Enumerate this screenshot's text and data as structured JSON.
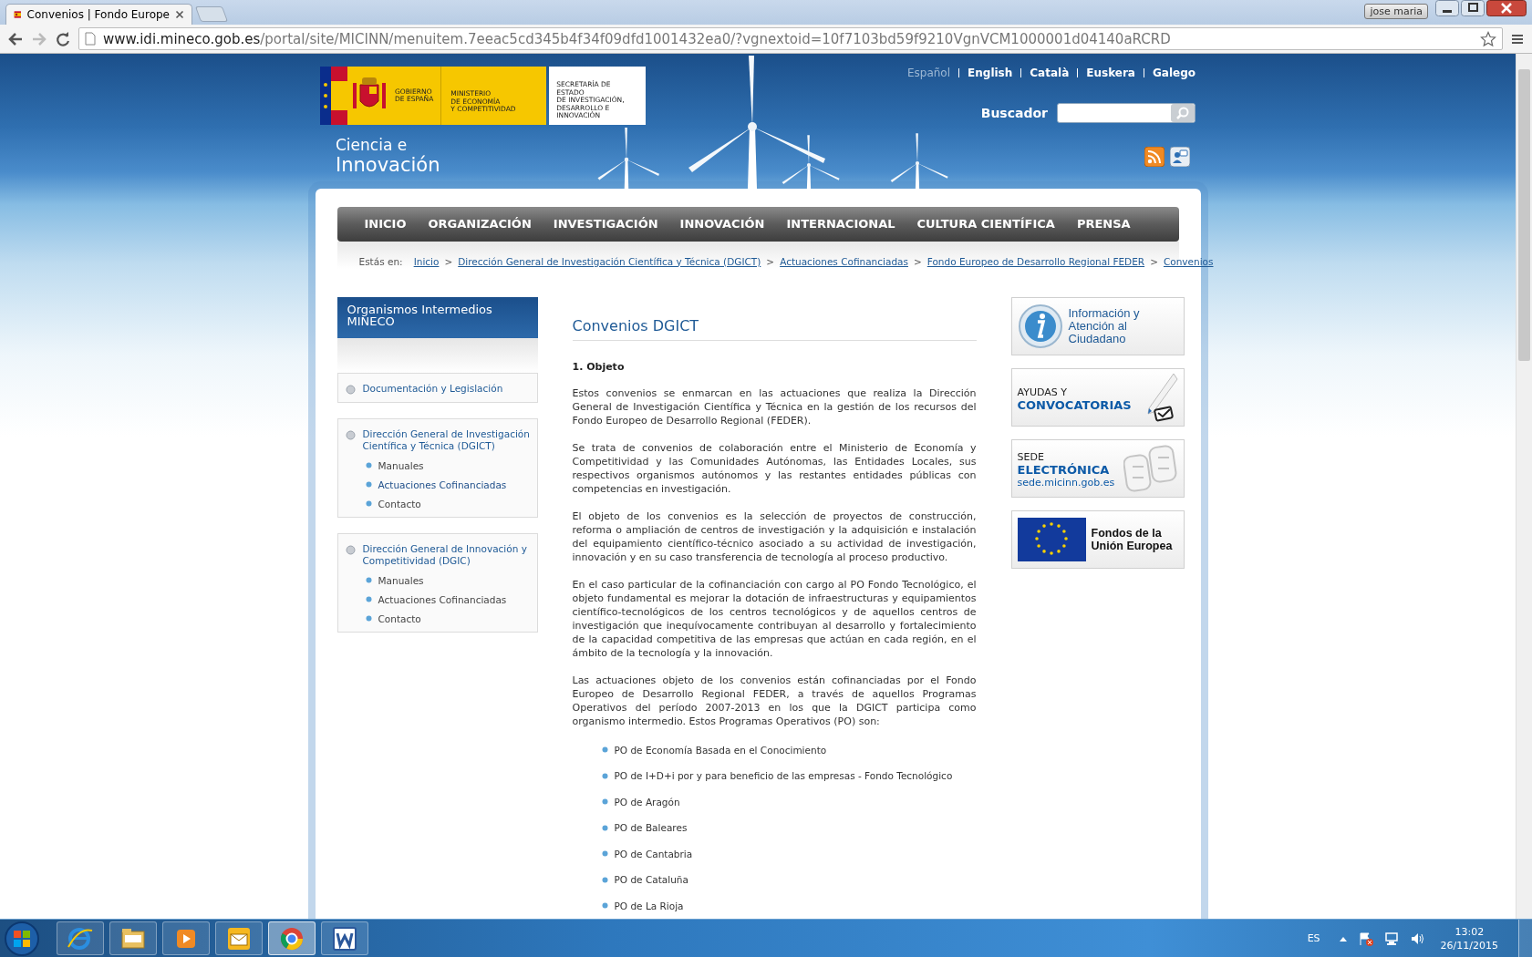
{
  "browser": {
    "tabs": [
      {
        "title": "Convenios | Fondo Europe",
        "selected": true
      }
    ],
    "user": "jose maria",
    "url_host": "www.idi.mineco.gob.es",
    "url_path": "/portal/site/MICINN/menuitem.7eeac5cd345b4f34f09dfd1001432ea0/?vgnextoid=10f7103bd59f9210VgnVCM1000001d04140aRCRD"
  },
  "header": {
    "logo": {
      "government": [
        "GOBIERNO",
        "DE ESPAÑA"
      ],
      "ministry": [
        "MINISTERIO",
        "DE ECONOMÍA",
        "Y COMPETITIVIDAD"
      ],
      "secretariat": [
        "SECRETARÍA DE ESTADO",
        "DE INVESTIGACIÓN,",
        "DESARROLLO E",
        "INNOVACIÓN"
      ]
    },
    "site_title": [
      "Ciencia e",
      "Innovación"
    ],
    "languages": [
      {
        "label": "Español",
        "selected": true
      },
      {
        "label": "English",
        "selected": false
      },
      {
        "label": "Català",
        "selected": false
      },
      {
        "label": "Euskera",
        "selected": false
      },
      {
        "label": "Galego",
        "selected": false
      }
    ],
    "search": {
      "label": "Buscador"
    }
  },
  "nav": [
    {
      "label": "INICIO",
      "selected": false
    },
    {
      "label": "ORGANIZACIÓN",
      "selected": false
    },
    {
      "label": "INVESTIGACIÓN",
      "selected": false
    },
    {
      "label": "INNOVACIÓN",
      "selected": false
    },
    {
      "label": "INTERNACIONAL",
      "selected": false
    },
    {
      "label": "CULTURA CIENTÍFICA",
      "selected": false
    },
    {
      "label": "PRENSA",
      "selected": false
    }
  ],
  "breadcrumb": {
    "label": "Estás en:",
    "separator": ">",
    "links": [
      "Inicio",
      "Dirección General de Investigación Científica y Técnica (DGICT)",
      "Actuaciones Cofinanciadas",
      "Fondo Europeo de Desarrollo Regional FEDER",
      "Convenios"
    ]
  },
  "sidebar": {
    "title": "Organismos Intermedios MINECO",
    "groups": [
      {
        "label": "Documentación y Legislación"
      },
      {
        "label": "Dirección General de Investigación Científica y Técnica (DGICT)",
        "children": [
          {
            "label": "Manuales",
            "selected": false
          },
          {
            "label": "Actuaciones Cofinanciadas",
            "selected": true
          },
          {
            "label": "Contacto",
            "selected": false
          }
        ]
      },
      {
        "label": "Dirección General de Innovación y Competitividad (DGIC)",
        "children": [
          {
            "label": "Manuales",
            "selected": false
          },
          {
            "label": "Actuaciones Cofinanciadas",
            "selected": false
          },
          {
            "label": "Contacto",
            "selected": false
          }
        ]
      }
    ]
  },
  "main": {
    "title": "Convenios DGICT",
    "heading": "1. Objeto",
    "paragraphs": [
      "Estos convenios se enmarcan en las actuaciones que realiza la Dirección General de Investigación Científica y Técnica en la gestión de los recursos del Fondo Europeo de Desarrollo Regional (FEDER).",
      "Se trata de convenios de colaboración entre el Ministerio de Economía y Competitividad y las Comunidades Autónomas, las Entidades Locales, sus respectivos organismos autónomos y las restantes entidades públicas con competencias en investigación.",
      "El objeto de los convenios es la selección de proyectos de construcción, reforma o ampliación de centros de investigación y la adquisición e instalación del equipamiento científico-técnico asociado a su actividad de investigación, innovación y en su caso transferencia de tecnología al proceso productivo.",
      "En el caso particular de la cofinanciación con cargo al PO Fondo Tecnológico, el objeto fundamental es mejorar la dotación de infraestructuras y equipamientos científico-tecnológicos de los centros tecnológicos y de aquellos centros de investigación que inequívocamente contribuyan al desarrollo y fortalecimiento de la capacidad competitiva de las empresas que actúan en cada región, en el ámbito de la tecnología y la innovación.",
      "Las actuaciones objeto de los convenios están cofinanciadas por el Fondo Europeo de Desarrollo Regional FEDER, a través de aquellos Programas Operativos del período 2007-2013 en los que la DGICT participa como organismo intermedio. Estos Programas Operativos (PO) son:"
    ],
    "list": [
      "PO de Economía Basada en el Conocimiento",
      "PO de I+D+i por y para beneficio de las empresas - Fondo Tecnológico",
      "PO de Aragón",
      "PO de Baleares",
      "PO de Cantabria",
      "PO de Cataluña",
      "PO de La Rioja"
    ]
  },
  "banners": [
    {
      "kind": "info",
      "lines": [
        "Información y",
        "Atención al",
        "Ciudadano"
      ]
    },
    {
      "kind": "grants",
      "lines": [
        "AYUDAS Y",
        "CONVOCATORIAS"
      ]
    },
    {
      "kind": "office",
      "lines": [
        "SEDE",
        "ELECTRÓNICA",
        "sede.micinn.gob.es"
      ]
    },
    {
      "kind": "eu",
      "lines": [
        "Fondos de la",
        "Unión Europea"
      ]
    }
  ],
  "taskbar": {
    "apps": [
      {
        "kind": "ie",
        "selected": false
      },
      {
        "kind": "explorer",
        "selected": false
      },
      {
        "kind": "media",
        "selected": false
      },
      {
        "kind": "mail",
        "selected": false
      },
      {
        "kind": "chrome",
        "selected": true
      },
      {
        "kind": "word",
        "selected": false
      }
    ],
    "language": "ES",
    "time": "13:02",
    "date": "26/11/2015"
  }
}
